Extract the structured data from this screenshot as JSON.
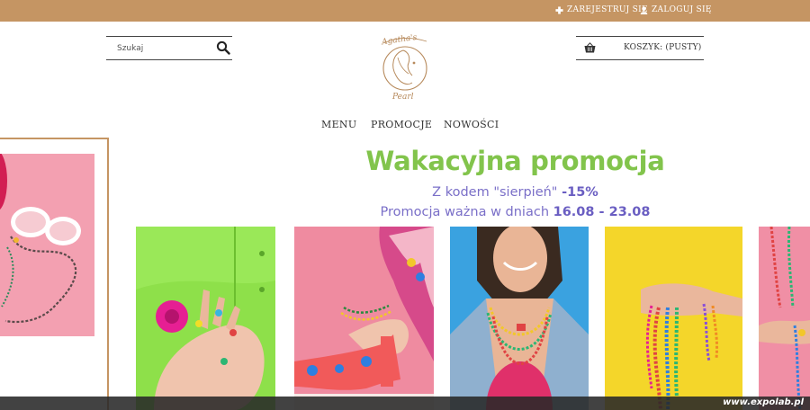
{
  "topbar": {
    "register_label": "ZAREJESTRUJ SIĘ",
    "login_label": "ZALOGUJ SIĘ"
  },
  "header": {
    "search": {
      "placeholder": "Szukaj"
    },
    "logo_text": "Agatha's Pearl",
    "cart": {
      "label": "KOSZYK: (PUSTY)"
    }
  },
  "nav": {
    "items": [
      {
        "label": "MENU"
      },
      {
        "label": "PROMOCJE"
      },
      {
        "label": "NOWOŚCI"
      }
    ]
  },
  "promo": {
    "title": "Wakacyjna promocja",
    "code_text": "Z kodem \"sierpień\"",
    "discount": "-15%",
    "valid_text": "Promocja ważna w dniach",
    "date_range": "16.08 - 23.08"
  },
  "watermark": "www.expolab.pl",
  "colors": {
    "topbar": "#c59563",
    "promo_title": "#82c44c",
    "promo_text": "#7a6fc8"
  },
  "icons": [
    "plus-icon",
    "user-icon",
    "search-icon",
    "basket-icon"
  ]
}
